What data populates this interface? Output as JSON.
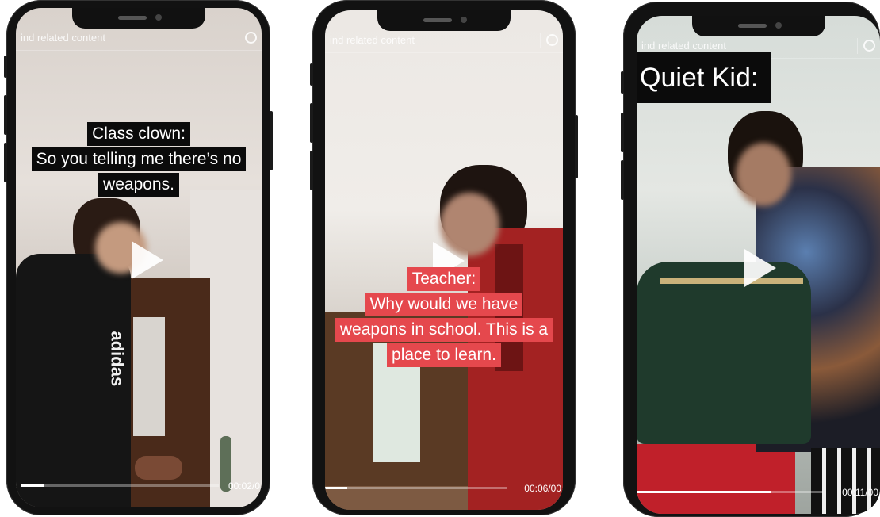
{
  "phones": [
    {
      "search_text": "ind related content",
      "caption_lines": [
        "Class clown:",
        "So you telling me there’s no",
        "weapons."
      ],
      "timestamp": "00:02/0",
      "progress": 0.12,
      "shirt_text": "adidas"
    },
    {
      "search_text": "ind related content",
      "caption_lines": [
        "Teacher:",
        "Why would we have",
        "weapons in school. This is a",
        "place to learn."
      ],
      "timestamp": "00:06/00",
      "progress": 0.12
    },
    {
      "search_text": "ind related content",
      "caption_lines": [
        "Quiet Kid:"
      ],
      "timestamp": "00:11/00",
      "progress": 0.72
    }
  ],
  "colors": {
    "caption_black": "#0b0b0b",
    "caption_red": "#e5484d"
  }
}
